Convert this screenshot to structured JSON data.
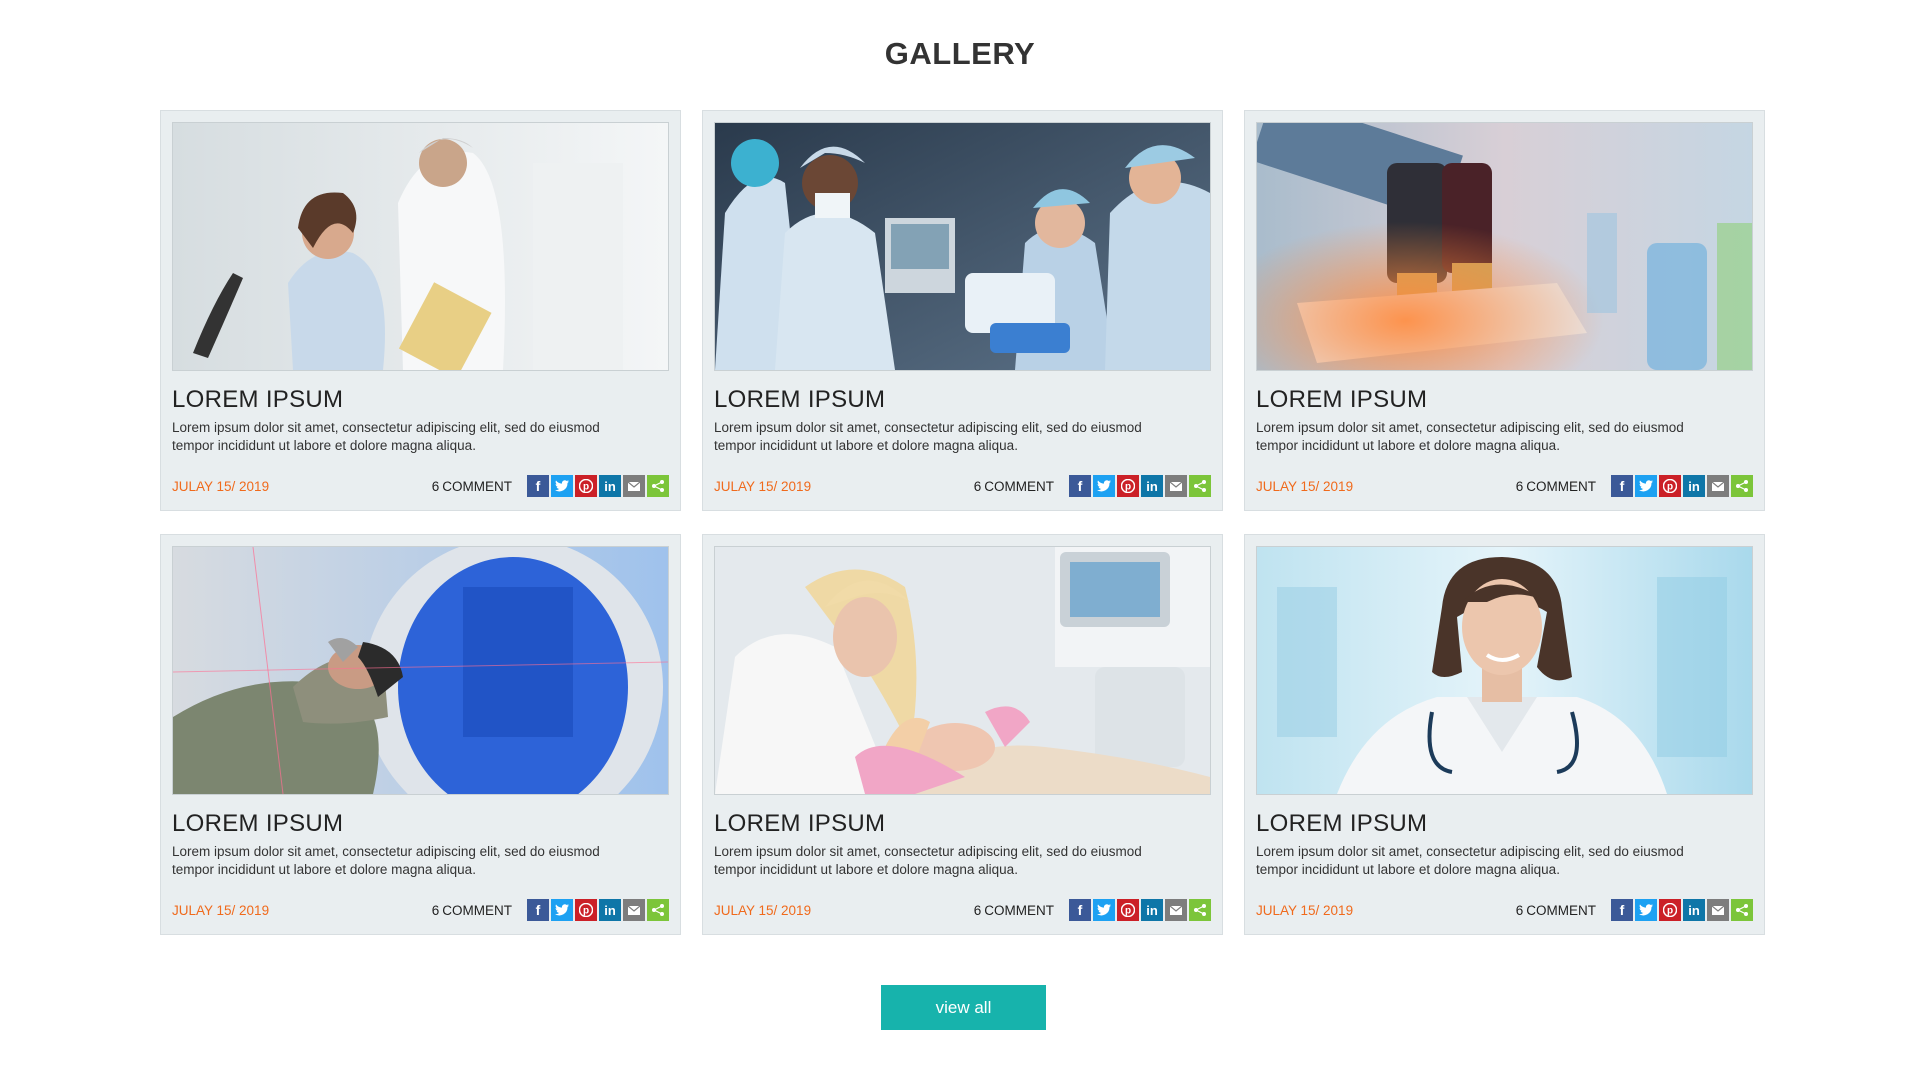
{
  "header": {
    "title": "GALLERY"
  },
  "colors": {
    "accent": "#17b3ac",
    "date": "#f06a1c",
    "facebook": "#3b5998",
    "twitter": "#1da1f2",
    "pinterest": "#cb2027",
    "linkedin": "#0e76a8",
    "email": "#7d7d7d",
    "share": "#7cc53a"
  },
  "cards": [
    {
      "title": "LOREM IPSUM",
      "text": "Lorem ipsum dolor sit amet, consectetur adipiscing elit, sed do eiusmod tempor incididunt ut labore et dolore magna aliqua.",
      "date": "JULAY 15/ 2019",
      "comment_count": "6",
      "comment_label": "COMMENT",
      "image": "doctor-and-patient-photo"
    },
    {
      "title": "LOREM IPSUM",
      "text": "Lorem ipsum dolor sit amet, consectetur adipiscing elit, sed do eiusmod tempor incididunt ut labore et dolore magna aliqua.",
      "date": "JULAY 15/ 2019",
      "comment_count": "6",
      "comment_label": "COMMENT",
      "image": "surgery-team-photo"
    },
    {
      "title": "LOREM IPSUM",
      "text": "Lorem ipsum dolor sit amet, consectetur adipiscing elit, sed do eiusmod tempor incididunt ut labore et dolore magna aliqua.",
      "date": "JULAY 15/ 2019",
      "comment_count": "6",
      "comment_label": "COMMENT",
      "image": "microscope-lab-photo"
    },
    {
      "title": "LOREM IPSUM",
      "text": "Lorem ipsum dolor sit amet, consectetur adipiscing elit, sed do eiusmod tempor incididunt ut labore et dolore magna aliqua.",
      "date": "JULAY 15/ 2019",
      "comment_count": "6",
      "comment_label": "COMMENT",
      "image": "mri-scanner-photo"
    },
    {
      "title": "LOREM IPSUM",
      "text": "Lorem ipsum dolor sit amet, consectetur adipiscing elit, sed do eiusmod tempor incididunt ut labore et dolore magna aliqua.",
      "date": "JULAY 15/ 2019",
      "comment_count": "6",
      "comment_label": "COMMENT",
      "image": "cosmetology-treatment-photo"
    },
    {
      "title": "LOREM IPSUM",
      "text": "Lorem ipsum dolor sit amet, consectetur adipiscing elit, sed do eiusmod tempor incididunt ut labore et dolore magna aliqua.",
      "date": "JULAY 15/ 2019",
      "comment_count": "6",
      "comment_label": "COMMENT",
      "image": "female-doctor-portrait-photo"
    }
  ],
  "share_icons": [
    "facebook-icon",
    "twitter-icon",
    "pinterest-icon",
    "linkedin-icon",
    "email-icon",
    "share-icon"
  ],
  "footer": {
    "view_all_label": "view all"
  }
}
